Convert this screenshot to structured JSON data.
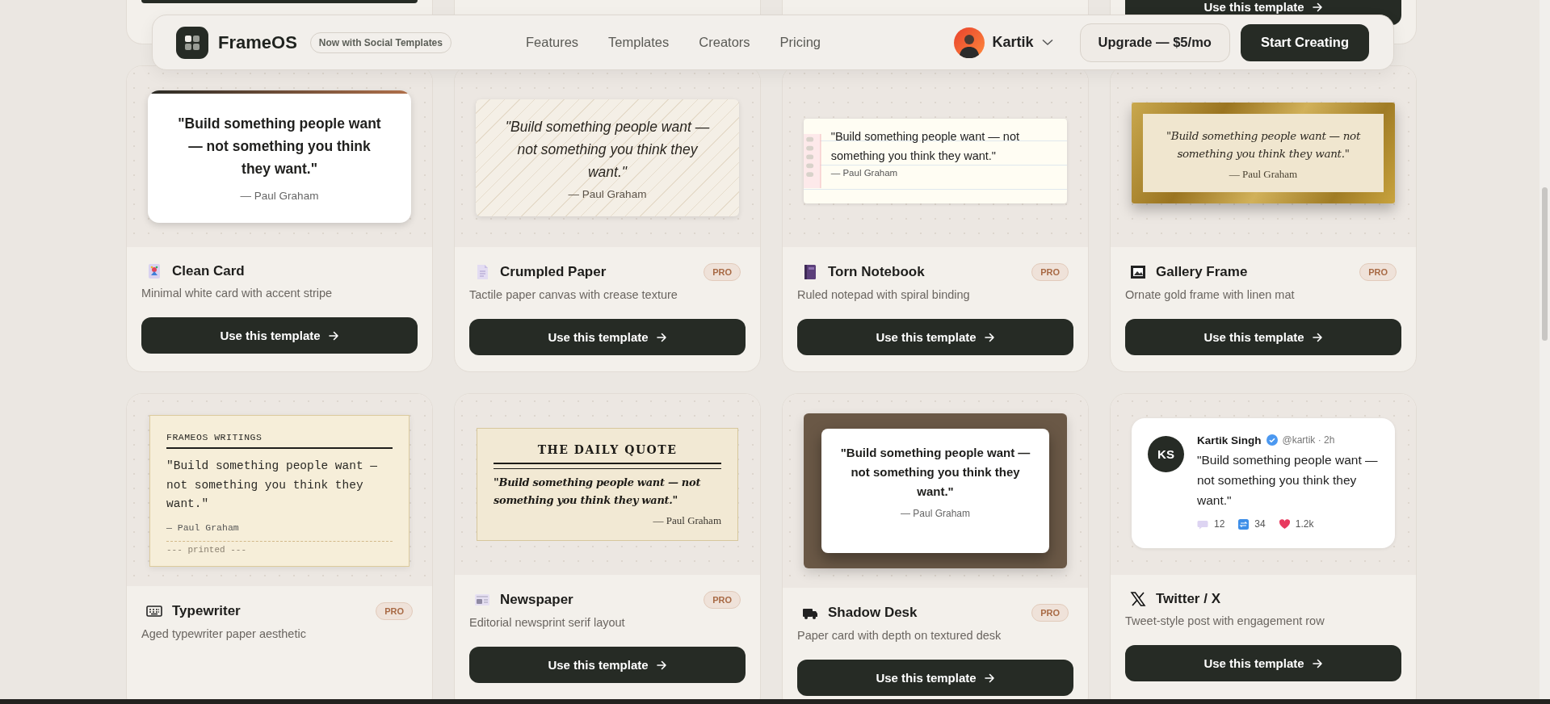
{
  "header": {
    "brand": "FrameOS",
    "badge": "Now with Social Templates",
    "nav": [
      "Features",
      "Templates",
      "Creators",
      "Pricing"
    ],
    "user": {
      "name": "Kartik"
    },
    "upgrade_button": "Upgrade — $5/mo",
    "cta_button": "Start Creating"
  },
  "top_row": [
    {
      "kind": "edge"
    },
    {
      "kind": "blank"
    },
    {
      "kind": "blank"
    },
    {
      "kind": "button",
      "button": "Use this template"
    }
  ],
  "templates": [
    {
      "kind": "clean",
      "name": "Clean Card",
      "description": "Minimal white card with accent stripe",
      "button": "Use this template",
      "preview": {
        "quote": "\"Build something people want — not something you think they want.\"",
        "author": "— Paul Graham"
      }
    },
    {
      "kind": "crumpled",
      "name": "Crumpled Paper",
      "description": "Tactile paper canvas with crease texture",
      "badge": "PRO",
      "button": "Use this template",
      "preview": {
        "quote": "\"Build something people want — not something you think they want.\"",
        "author": "— Paul Graham"
      }
    },
    {
      "kind": "notebook",
      "name": "Torn Notebook",
      "description": "Ruled notepad with spiral binding",
      "badge": "PRO",
      "button": "Use this template",
      "preview": {
        "quote": "\"Build something people want — not something you think they want.\"",
        "author": "— Paul Graham"
      }
    },
    {
      "kind": "gallery",
      "name": "Gallery Frame",
      "description": "Ornate gold frame with linen mat",
      "badge": "PRO",
      "button": "Use this template",
      "preview": {
        "quote": "\"Build something people want — not something you think they want.\"",
        "author": "— Paul Graham"
      }
    },
    {
      "kind": "typewriter",
      "name": "Typewriter",
      "description": "Aged typewriter paper aesthetic",
      "badge": "PRO",
      "preview": {
        "heading": "FRAMEOS WRITINGS",
        "quote": "\"Build something people want — not something you think they want.\"",
        "author": "— Paul Graham",
        "footer": "--- printed ---"
      }
    },
    {
      "kind": "newspaper",
      "name": "Newspaper",
      "description": "Editorial newsprint serif layout",
      "badge": "PRO",
      "button": "Use this template",
      "preview": {
        "heading": "THE DAILY QUOTE",
        "quote": "\"Build something people want — not something you think they want.\"",
        "author": "— Paul Graham"
      }
    },
    {
      "kind": "shadow",
      "name": "Shadow Desk",
      "description": "Paper card with depth on textured desk",
      "badge": "PRO",
      "button": "Use this template",
      "preview": {
        "quote": "\"Build something people want — not something you think they want.\"",
        "author": "— Paul Graham"
      }
    },
    {
      "kind": "tweet",
      "name": "Twitter / X",
      "description": "Tweet-style post with engagement row",
      "button": "Use this template",
      "preview": {
        "initials": "KS",
        "author_name": "Kartik Singh",
        "handle": "@kartik · 2h",
        "quote": "\"Build something people want — not something you think they want.\"",
        "stats": [
          {
            "kind": "reply",
            "count": "12"
          },
          {
            "kind": "repost",
            "count": "34"
          },
          {
            "kind": "like",
            "count": "1.2k"
          }
        ]
      }
    }
  ]
}
